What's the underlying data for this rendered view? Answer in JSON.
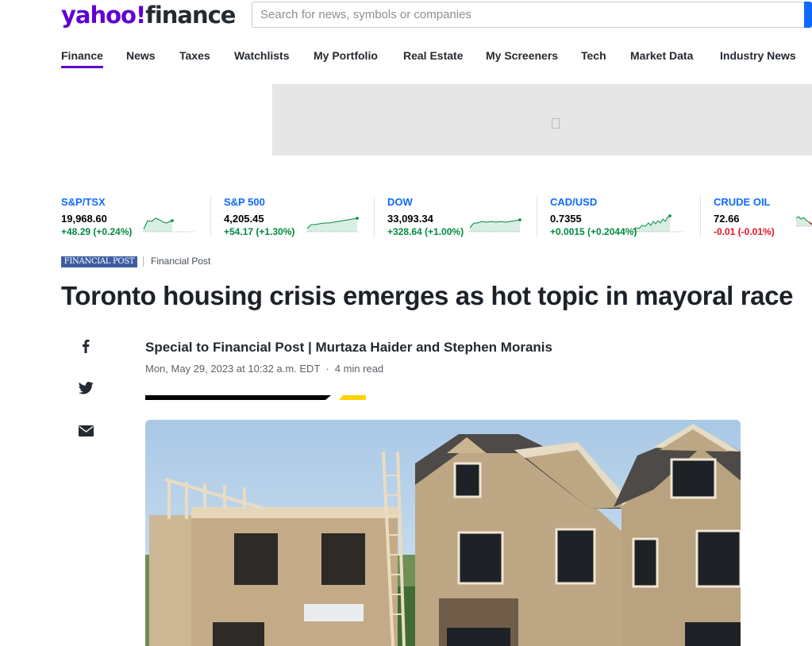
{
  "header": {
    "logo_main": "yahoo!",
    "logo_sub": "finance",
    "search_placeholder": "Search for news, symbols or companies"
  },
  "nav": {
    "items": [
      "Finance",
      "News",
      "Taxes",
      "Watchlists",
      "My Portfolio",
      "Real Estate",
      "My Screeners",
      "Tech",
      "Market Data",
      "Industry News"
    ],
    "active": "Finance"
  },
  "tickers": [
    {
      "name": "S&P/TSX",
      "price": "19,968.60",
      "change": "+48.29 (+0.24%)",
      "direction": "up"
    },
    {
      "name": "S&P 500",
      "price": "4,205.45",
      "change": "+54.17 (+1.30%)",
      "direction": "up"
    },
    {
      "name": "DOW",
      "price": "33,093.34",
      "change": "+328.64 (+1.00%)",
      "direction": "up"
    },
    {
      "name": "CAD/USD",
      "price": "0.7355",
      "change": "+0.0015 (+0.2044%)",
      "direction": "up"
    },
    {
      "name": "CRUDE OIL",
      "price": "72.66",
      "change": "-0.01 (-0.01%)",
      "direction": "down"
    }
  ],
  "article": {
    "source_logo_text": "FINANCIAL POST",
    "source_name": "Financial Post",
    "headline": "Toronto housing crisis emerges as hot topic in mayoral race",
    "byline": "Special to Financial Post | Murtaza Haider and Stephen Moranis",
    "date": "Mon, May 29, 2023 at 10:32 a.m. EDT",
    "read_time": "4 min read"
  },
  "share": {
    "facebook_icon": "facebook-icon",
    "twitter_icon": "twitter-icon",
    "email_icon": "email-icon"
  },
  "colors": {
    "brand": "#6001d2",
    "link": "#0f69ff",
    "up": "#008a3f",
    "down": "#eb0f29"
  }
}
